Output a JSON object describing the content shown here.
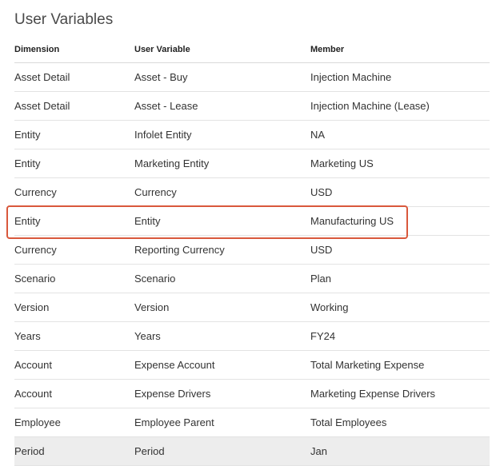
{
  "title": "User Variables",
  "columns": {
    "dimension": "Dimension",
    "user_variable": "User Variable",
    "member": "Member"
  },
  "rows": [
    {
      "dimension": "Asset Detail",
      "user_variable": "Asset - Buy",
      "member": "Injection Machine",
      "highlight": false,
      "selected": false
    },
    {
      "dimension": "Asset Detail",
      "user_variable": "Asset - Lease",
      "member": "Injection Machine (Lease)",
      "highlight": false,
      "selected": false
    },
    {
      "dimension": "Entity",
      "user_variable": "Infolet Entity",
      "member": "NA",
      "highlight": false,
      "selected": false
    },
    {
      "dimension": "Entity",
      "user_variable": "Marketing Entity",
      "member": "Marketing US",
      "highlight": false,
      "selected": false
    },
    {
      "dimension": "Currency",
      "user_variable": "Currency",
      "member": "USD",
      "highlight": false,
      "selected": false
    },
    {
      "dimension": "Entity",
      "user_variable": "Entity",
      "member": "Manufacturing US",
      "highlight": true,
      "selected": false
    },
    {
      "dimension": "Currency",
      "user_variable": "Reporting Currency",
      "member": "USD",
      "highlight": false,
      "selected": false
    },
    {
      "dimension": "Scenario",
      "user_variable": "Scenario",
      "member": "Plan",
      "highlight": false,
      "selected": false
    },
    {
      "dimension": "Version",
      "user_variable": "Version",
      "member": "Working",
      "highlight": false,
      "selected": false
    },
    {
      "dimension": "Years",
      "user_variable": "Years",
      "member": "FY24",
      "highlight": false,
      "selected": false
    },
    {
      "dimension": "Account",
      "user_variable": "Expense Account",
      "member": "Total Marketing Expense",
      "highlight": false,
      "selected": false
    },
    {
      "dimension": "Account",
      "user_variable": "Expense Drivers",
      "member": "Marketing Expense Drivers",
      "highlight": false,
      "selected": false
    },
    {
      "dimension": "Employee",
      "user_variable": "Employee Parent",
      "member": "Total Employees",
      "highlight": false,
      "selected": false
    },
    {
      "dimension": "Period",
      "user_variable": "Period",
      "member": "Jan",
      "highlight": false,
      "selected": true
    }
  ],
  "highlight_color": "#d9583c"
}
